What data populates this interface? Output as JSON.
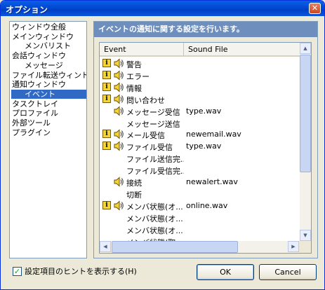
{
  "window": {
    "title": "オプション",
    "close_glyph": "✕"
  },
  "nav": {
    "items": [
      {
        "label": "ウィンドウ全般",
        "indent": 0
      },
      {
        "label": "メインウィンドウ",
        "indent": 0
      },
      {
        "label": "メンバリスト",
        "indent": 2
      },
      {
        "label": "会話ウィンドウ",
        "indent": 0
      },
      {
        "label": "メッセージ",
        "indent": 2
      },
      {
        "label": "ファイル転送ウィンドウ",
        "indent": 0
      },
      {
        "label": "通知ウィンドウ",
        "indent": 0
      },
      {
        "label": "イベント",
        "indent": 2,
        "selected": true
      },
      {
        "label": "タスクトレイ",
        "indent": 0
      },
      {
        "label": "プロファイル",
        "indent": 0
      },
      {
        "label": "外部ツール",
        "indent": 0
      },
      {
        "label": "プラグイン",
        "indent": 0
      }
    ]
  },
  "panel": {
    "header": "イベントの通知に関する設定を行います。",
    "columns": {
      "event": "Event",
      "sound": "Sound File"
    },
    "rows": [
      {
        "info": true,
        "sound": true,
        "event": "警告",
        "file": ""
      },
      {
        "info": true,
        "sound": true,
        "event": "エラー",
        "file": ""
      },
      {
        "info": true,
        "sound": true,
        "event": "情報",
        "file": ""
      },
      {
        "info": true,
        "sound": true,
        "event": "問い合わせ",
        "file": ""
      },
      {
        "info": false,
        "sound": true,
        "event": "メッセージ受信",
        "file": "type.wav"
      },
      {
        "info": false,
        "sound": false,
        "event": "メッセージ送信",
        "file": ""
      },
      {
        "info": true,
        "sound": true,
        "event": "メール受信",
        "file": "newemail.wav"
      },
      {
        "info": true,
        "sound": true,
        "event": "ファイル受信",
        "file": "type.wav"
      },
      {
        "info": false,
        "sound": false,
        "event": "ファイル送信完...",
        "file": ""
      },
      {
        "info": false,
        "sound": false,
        "event": "ファイル受信完...",
        "file": ""
      },
      {
        "info": false,
        "sound": true,
        "event": "接続",
        "file": "newalert.wav"
      },
      {
        "info": false,
        "sound": false,
        "event": "切断",
        "file": ""
      },
      {
        "info": true,
        "sound": true,
        "event": "メンバ状態(オ...",
        "file": "online.wav"
      },
      {
        "info": false,
        "sound": false,
        "event": "メンバ状態(オ...",
        "file": ""
      },
      {
        "info": false,
        "sound": false,
        "event": "メンバ状態(オ...",
        "file": ""
      },
      {
        "info": false,
        "sound": false,
        "event": "メンバ状態(取...",
        "file": ""
      }
    ]
  },
  "footer": {
    "checkbox_label": "設定項目のヒントを表示する(H)",
    "checkbox_checked": true,
    "ok_label": "OK",
    "cancel_label": "Cancel"
  },
  "icons": {
    "info": "info-icon",
    "sound": "speaker-icon"
  },
  "colors": {
    "title_bar": "#0054e3",
    "selection": "#316ac5",
    "panel_header": "#6e8fbe"
  }
}
